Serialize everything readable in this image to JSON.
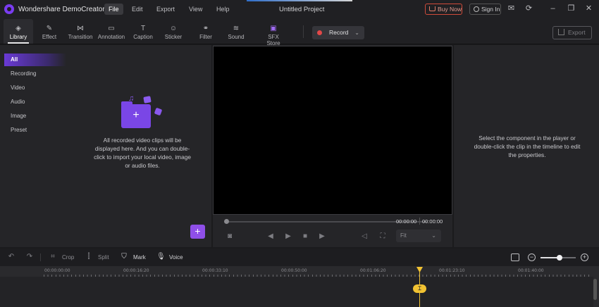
{
  "app": {
    "name": "Wondershare DemoCreator",
    "project_title": "Untitled Project",
    "brand_color": "#7a3cf0"
  },
  "menu": {
    "items": [
      "File",
      "Edit",
      "Export",
      "View",
      "Help"
    ],
    "active": "File"
  },
  "titlebar": {
    "buy_label": "Buy Now",
    "signin_label": "Sign In"
  },
  "toolbar": {
    "tools": [
      {
        "label": "Library",
        "icon": "library-icon"
      },
      {
        "label": "Effect",
        "icon": "effect-icon"
      },
      {
        "label": "Transition",
        "icon": "transition-icon"
      },
      {
        "label": "Annotation",
        "icon": "annotation-icon"
      },
      {
        "label": "Caption",
        "icon": "caption-icon"
      },
      {
        "label": "Sticker",
        "icon": "sticker-icon"
      },
      {
        "label": "Filter",
        "icon": "filter-icon"
      },
      {
        "label": "Sound",
        "icon": "sound-icon"
      },
      {
        "label": "SFX Store",
        "icon": "sfx-store-icon"
      }
    ],
    "active": "Library",
    "record_label": "Record",
    "export_label": "Export"
  },
  "library": {
    "categories": [
      "All",
      "Recording",
      "Video",
      "Audio",
      "Image",
      "Preset"
    ],
    "active": "All",
    "empty_message": "All recorded video clips will be displayed here. And you can double-click to import your local video, image or audio files."
  },
  "player": {
    "current_time": "00:00:00",
    "total_time": "00:00:00",
    "fit_option": "Fit"
  },
  "properties": {
    "hint": "Select the component in the player or double-click the clip in the timeline to edit the properties."
  },
  "timeline_toolbar": {
    "crop_label": "Crop",
    "split_label": "Split",
    "mark_label": "Mark",
    "voice_label": "Voice"
  },
  "timeline": {
    "ruler_labels": [
      "00:00:00:00",
      "00:00:16:20",
      "00:00:33:10",
      "00:00:50:00",
      "00:01:06:20",
      "00:01:23:10",
      "00:01:40:00"
    ],
    "playhead_color": "#f1c232"
  }
}
